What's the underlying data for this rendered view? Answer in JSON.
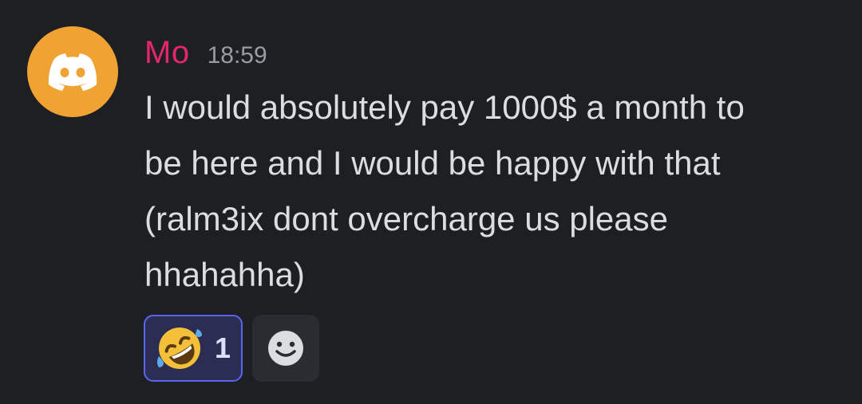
{
  "message": {
    "author": {
      "name": "Mo",
      "color": "#e5266c",
      "avatar_icon": "discord-logo-icon",
      "avatar_color": "#f0a232"
    },
    "timestamp": "18:59",
    "content_lines": [
      "I would absolutely pay 1000$ a month to",
      "be here and I would be happy with that",
      "(ralm3ix dont overcharge us please",
      "hhahahha)"
    ],
    "reactions": [
      {
        "emoji_icon": "rolling-on-floor-laughing-emoji-icon",
        "count": "1",
        "selected": true
      }
    ],
    "add_reaction_icon": "smiley-face-icon"
  }
}
